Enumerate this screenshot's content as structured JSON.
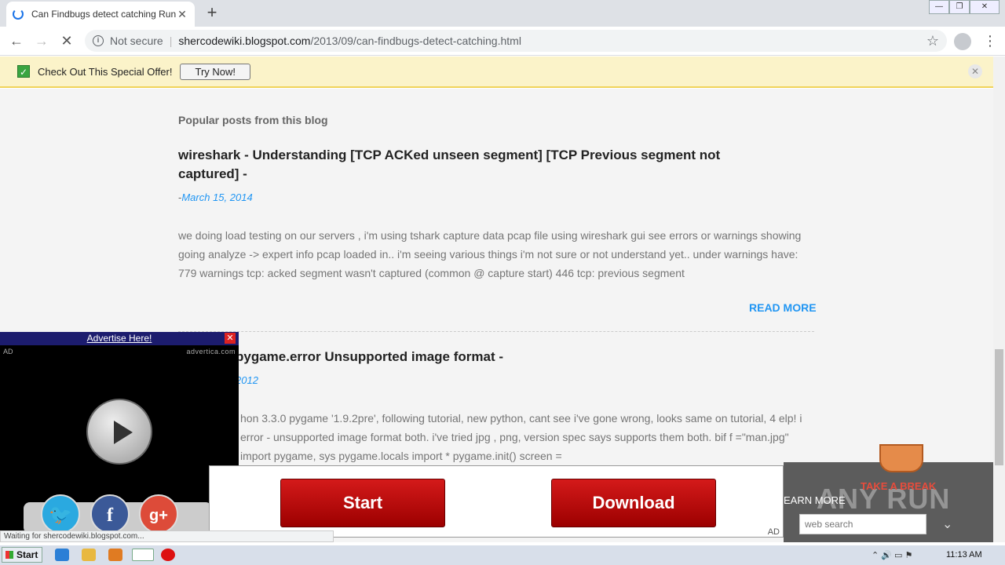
{
  "browser": {
    "tab_title": "Can Findbugs detect catching Runtim",
    "url_status": "Not secure",
    "url_host": "shercodewiki.blogspot.com",
    "url_path": "/2013/09/can-findbugs-detect-catching.html",
    "status_text": "Waiting for shercodewiki.blogspot.com..."
  },
  "offer_bar": {
    "text": "Check Out This Special Offer!",
    "button": "Try Now!"
  },
  "blog": {
    "section_heading": "Popular posts from this blog",
    "posts": [
      {
        "title": "wireshark - Understanding [TCP ACKed unseen segment] [TCP Previous segment not captured] -",
        "date": "March 15, 2014",
        "excerpt": "we doing load testing on our servers , i'm using tshark capture data pcap file using wireshark gui see errors or warnings showing going analyze -> expert info pcap loaded in.. i'm seeing various things i'm not sure or not understand yet.. under warnings have: 779 warnings tcp: acked segment wasn't captured (common @ capture start) 446 tcp: previous segment",
        "read_more": "READ MORE"
      },
      {
        "title": "pygame.error Unsupported image format -",
        "date": "2012",
        "excerpt": "hon 3.3.0 pygame '1.9.2pre', following tutorial, new python, cant see i've gone wrong, looks same on tutorial, 4 elp! i error - unsupported image format both. i've tried jpg , png, version spec says supports them both. bif f =\"man.jpg\" import pygame, sys pygame.locals import * pygame.init() screen ="
      }
    ]
  },
  "video_ad": {
    "header": "Advertise Here!",
    "ad_label": "AD",
    "source": "advertica.com"
  },
  "download_ad": {
    "start": "Start",
    "download": "Download",
    "ad_label": "AD"
  },
  "side_widget": {
    "learn_more": "EARN MORE",
    "search_placeholder": "web search",
    "take_a_break": "TAKE A BREAK",
    "watermark": "ANY RUN"
  },
  "taskbar": {
    "start": "Start",
    "clock": "11:13 AM"
  },
  "icons": [
    "spinner-icon",
    "close-icon",
    "plus-icon",
    "back-icon",
    "forward-icon",
    "stop-icon",
    "info-icon",
    "star-icon",
    "profile-icon",
    "menu-icon",
    "check-icon",
    "play-icon",
    "twitter-icon",
    "facebook-icon",
    "googleplus-icon",
    "chevron-down-icon"
  ]
}
